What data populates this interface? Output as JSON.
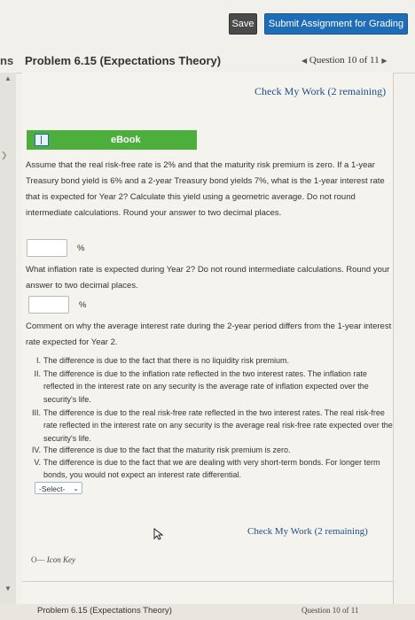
{
  "toolbar": {
    "save_label": "Save",
    "submit_label": "Submit Assignment for Grading"
  },
  "header": {
    "left_fragment": "ns",
    "problem_title": "Problem 6.15 (Expectations Theory)",
    "question_nav": "Question 10 of 11"
  },
  "check_my_work_top": "Check My Work (2 remaining)",
  "ebook_label": "eBook",
  "question": {
    "part1": "Assume that the real risk-free rate is 2% and that the maturity risk premium is zero. If a 1-year Treasury bond yield is 6% and a 2-year Treasury bond yields 7%, what is the 1-year interest rate that is expected for Year 2? Calculate this yield using a geometric average. Do not round intermediate calculations. Round your answer to two decimal places.",
    "part1_unit": "%",
    "part2": "What inflation rate is expected during Year 2? Do not round intermediate calculations. Round your answer to two decimal places.",
    "part2_unit": "%",
    "part3": "Comment on why the average interest rate during the 2-year period differs from the 1-year interest rate expected for Year 2.",
    "options": [
      {
        "num": "I.",
        "text": "The difference is due to the fact that there is no liquidity risk premium."
      },
      {
        "num": "II.",
        "text": "The difference is due to the inflation rate reflected in the two interest rates. The inflation rate reflected in the interest rate on any security is the average rate of inflation expected over the security's life."
      },
      {
        "num": "III.",
        "text": "The difference is due to the real risk-free rate reflected in the two interest rates. The real risk-free rate reflected in the interest rate on any security is the average real risk-free rate expected over the security's life."
      },
      {
        "num": "IV.",
        "text": "The difference is due to the fact that the maturity risk premium is zero."
      },
      {
        "num": "V.",
        "text": "The difference is due to the fact that we are dealing with very short-term bonds. For longer term bonds, you would not expect an interest rate differential."
      }
    ],
    "select_value": "-Select-"
  },
  "check_my_work_bottom": "Check My Work (2 remaining)",
  "icon_key_label": "Icon Key",
  "footer": {
    "title": "Problem 6.15 (Expectations Theory)",
    "question_nav": "Question 10 of 11"
  },
  "colors": {
    "save_bg": "#4a4a4a",
    "submit_bg": "#1f6db6",
    "ebook_bg": "#4caf3c",
    "link": "#1f4f8a"
  }
}
